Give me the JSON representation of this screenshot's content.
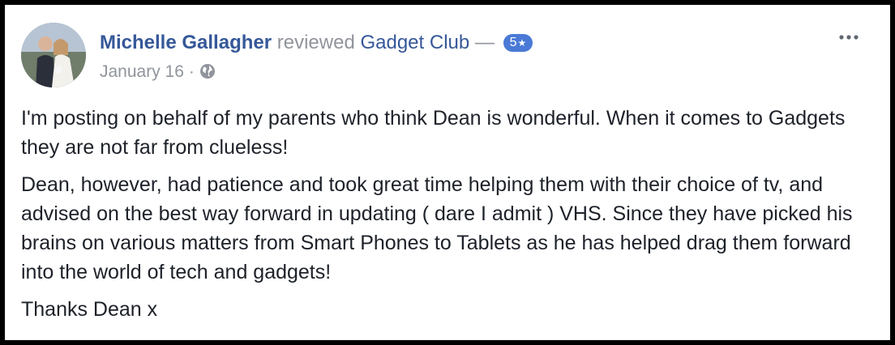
{
  "post": {
    "author": "Michelle Gallagher",
    "verb": "reviewed",
    "page": "Gadget Club",
    "dash": "—",
    "rating": "5",
    "rating_star": "★",
    "date": "January 16",
    "separator": "·",
    "privacy_icon": "globe-icon",
    "more_icon": "more-options-icon"
  },
  "review": {
    "paragraphs": [
      "I'm posting on behalf of my parents who think Dean is wonderful. When it comes to Gadgets they are not far from clueless!",
      "Dean, however, had patience and took great time helping them with their choice of tv, and advised on the best way forward in updating ( dare I admit ) VHS. Since they have picked his brains on various matters from Smart Phones to Tablets as he has helped drag them forward into the world of tech and gadgets!",
      "Thanks Dean x"
    ]
  },
  "colors": {
    "link": "#365899",
    "muted": "#90949c",
    "text": "#1d2129",
    "badge": "#4a7ad6",
    "border": "#000000"
  }
}
